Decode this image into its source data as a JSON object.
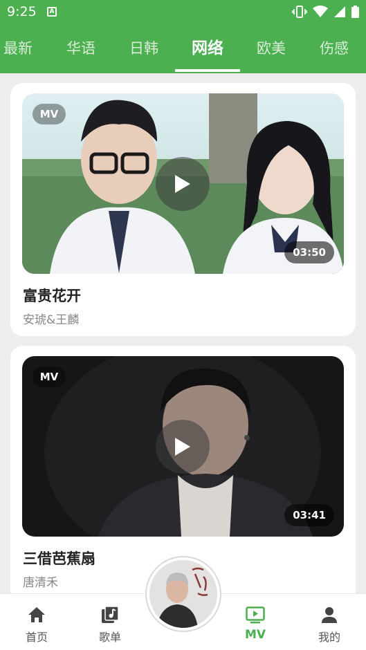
{
  "status_bar": {
    "time": "9:25",
    "notif_icon": "A"
  },
  "tabs": [
    {
      "label": "最新"
    },
    {
      "label": "华语"
    },
    {
      "label": "日韩"
    },
    {
      "label": "网络"
    },
    {
      "label": "欧美"
    },
    {
      "label": "伤感"
    }
  ],
  "active_tab": "网络",
  "videos": [
    {
      "badge": "MV",
      "duration": "03:50",
      "title": "富贵花开",
      "artist": "安琥&王麟"
    },
    {
      "badge": "MV",
      "duration": "03:41",
      "title": "三借芭蕉扇",
      "artist": "唐清禾"
    }
  ],
  "bottom_nav": [
    {
      "label": "首页",
      "icon": "home-icon"
    },
    {
      "label": "歌单",
      "icon": "playlist-icon"
    },
    {
      "label": "MV",
      "icon": "tv-play-icon"
    },
    {
      "label": "我的",
      "icon": "person-icon"
    }
  ],
  "active_nav": "MV",
  "colors": {
    "primary": "#4caf50",
    "background": "#eeeeee",
    "card": "#ffffff"
  }
}
